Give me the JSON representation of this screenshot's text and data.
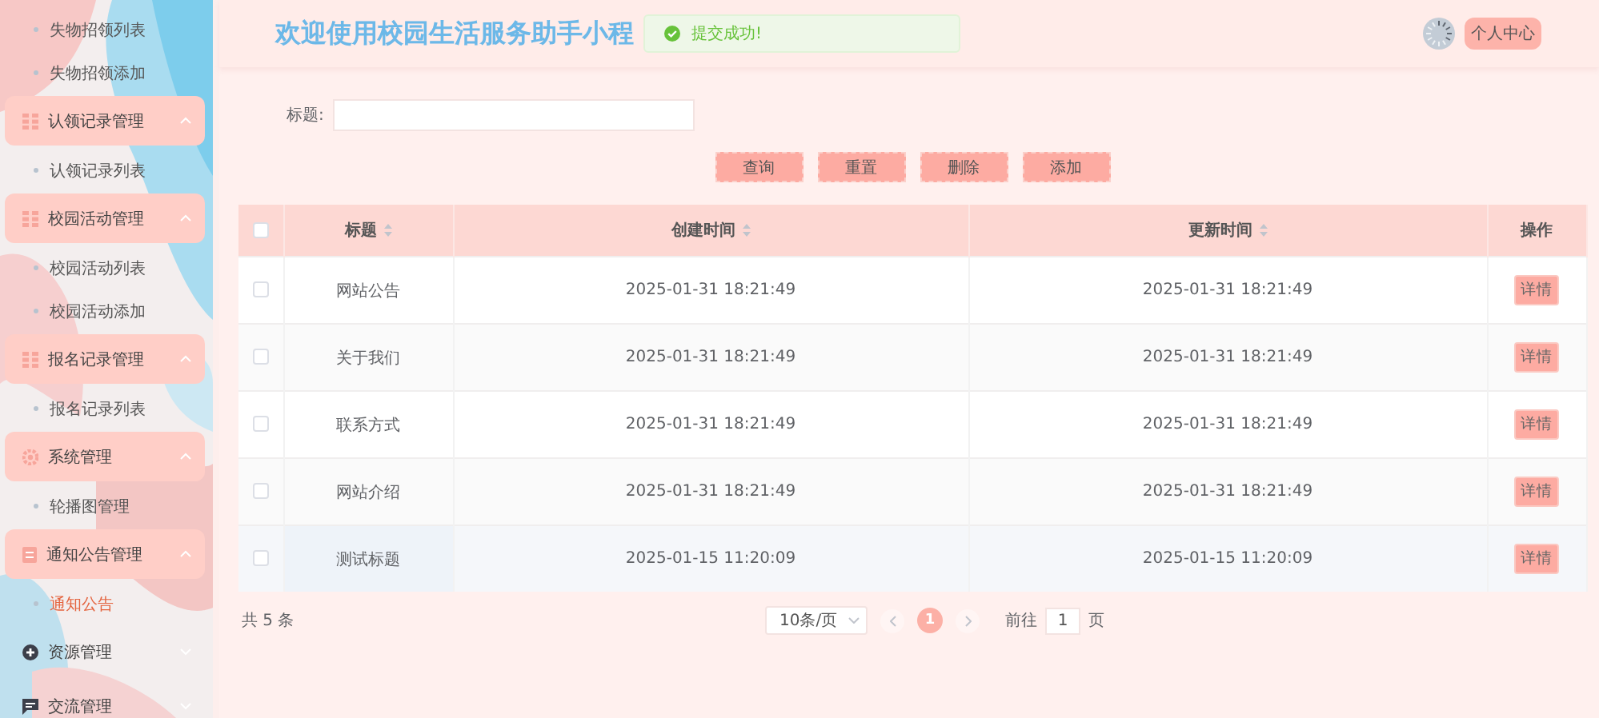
{
  "sidebar": {
    "items": [
      {
        "kind": "link",
        "label": "失物招领列表",
        "selected": false
      },
      {
        "kind": "link",
        "label": "失物招领添加",
        "selected": false
      },
      {
        "kind": "group",
        "label": "认领记录管理",
        "expanded": true,
        "children": [
          {
            "label": "认领记录列表",
            "selected": false
          }
        ]
      },
      {
        "kind": "group",
        "label": "校园活动管理",
        "expanded": true,
        "children": [
          {
            "label": "校园活动列表",
            "selected": false
          },
          {
            "label": "校园活动添加",
            "selected": false
          }
        ]
      },
      {
        "kind": "group",
        "label": "报名记录管理",
        "expanded": true,
        "children": [
          {
            "label": "报名记录列表",
            "selected": false
          }
        ]
      },
      {
        "kind": "group",
        "label": "系统管理",
        "expanded": true,
        "children": [
          {
            "label": "轮播图管理",
            "selected": false
          }
        ]
      },
      {
        "kind": "group",
        "label": "通知公告管理",
        "expanded": true,
        "children": [
          {
            "label": "通知公告",
            "selected": true
          }
        ]
      },
      {
        "kind": "group",
        "label": "资源管理",
        "expanded": false
      },
      {
        "kind": "group",
        "label": "交流管理",
        "expanded": false
      }
    ]
  },
  "header": {
    "title": "欢迎使用校园生活服务助手小程",
    "toast": "提交成功!",
    "user_button": "个人中心"
  },
  "search": {
    "label": "标题:",
    "buttons": [
      "查询",
      "重置",
      "删除",
      "添加"
    ]
  },
  "table": {
    "header_checked": false,
    "columns": [
      {
        "label": "标题",
        "sortable": true
      },
      {
        "label": "创建时间",
        "sortable": true
      },
      {
        "label": "更新时间",
        "sortable": true
      },
      {
        "label": "操作",
        "sortable": false
      }
    ],
    "rows": [
      {
        "checked": false,
        "hovered": false,
        "cells": [
          "网站公告",
          "2025-01-31 18:21:49",
          "2025-01-31 18:21:49"
        ],
        "action": "详情"
      },
      {
        "checked": false,
        "hovered": false,
        "cells": [
          "关于我们",
          "2025-01-31 18:21:49",
          "2025-01-31 18:21:49"
        ],
        "action": "详情"
      },
      {
        "checked": false,
        "hovered": false,
        "cells": [
          "联系方式",
          "2025-01-31 18:21:49",
          "2025-01-31 18:21:49"
        ],
        "action": "详情"
      },
      {
        "checked": false,
        "hovered": false,
        "cells": [
          "网站介绍",
          "2025-01-31 18:21:49",
          "2025-01-31 18:21:49"
        ],
        "action": "详情"
      },
      {
        "checked": false,
        "hovered": true,
        "cells": [
          "测试标题",
          "2025-01-15 11:20:09",
          "2025-01-15 11:20:09"
        ],
        "action": "详情"
      }
    ]
  },
  "pagination": {
    "total": "共 5 条",
    "page_size": "10条/页",
    "pages": [
      {
        "label": "1",
        "selected": true
      }
    ],
    "goto_label": "前往",
    "goto_value": "1",
    "goto_suffix": "页"
  }
}
